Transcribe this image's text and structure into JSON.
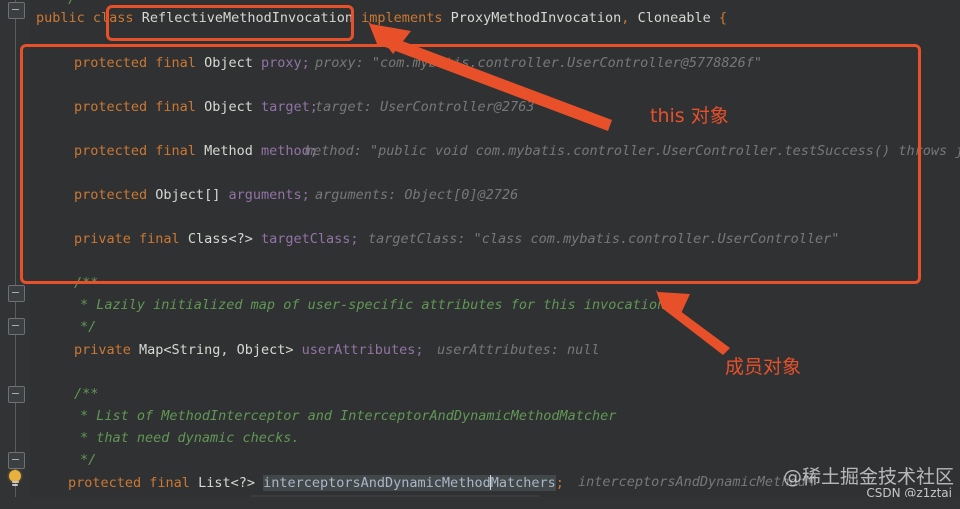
{
  "editor": {
    "theme_background": "#2f3133",
    "gutter_background": "#313335",
    "accent_annotation_color": "#e8502a",
    "comment_color": "#629755",
    "keyword_color": "#cc7832",
    "hint_color": "#787878"
  },
  "code_lines": [
    {
      "id": "l0",
      "text": "*/"
    },
    {
      "id": "l1",
      "text": "public class ReflectiveMethodInvocation implements ProxyMethodInvocation, Cloneable {"
    },
    {
      "id": "l2",
      "text": "protected final Object proxy;"
    },
    {
      "id": "l2h",
      "text": "proxy: \"com.mybatis.controller.UserController@5778826f\""
    },
    {
      "id": "l3",
      "text": "protected final Object target;"
    },
    {
      "id": "l3h",
      "text": "target: UserController@2763"
    },
    {
      "id": "l4",
      "text": "protected final Method method;"
    },
    {
      "id": "l4h",
      "text": "method: \"public void com.mybatis.controller.UserController.testSuccess() throws jav"
    },
    {
      "id": "l5",
      "text": "protected Object[] arguments;"
    },
    {
      "id": "l5h",
      "text": "arguments: Object[0]@2726"
    },
    {
      "id": "l6",
      "text": "private final Class<?> targetClass;"
    },
    {
      "id": "l6h",
      "text": "targetClass: \"class com.mybatis.controller.UserController\""
    },
    {
      "id": "l7",
      "text": "/**"
    },
    {
      "id": "l8",
      "text": "* Lazily initialized map of user-specific attributes for this invocation."
    },
    {
      "id": "l9",
      "text": "*/"
    },
    {
      "id": "l10",
      "text": "private Map<String, Object> userAttributes;"
    },
    {
      "id": "l10h",
      "text": "userAttributes: null"
    },
    {
      "id": "l11",
      "text": "/**"
    },
    {
      "id": "l12",
      "text": "* List of MethodInterceptor and InterceptorAndDynamicMethodMatcher"
    },
    {
      "id": "l13",
      "text": "* that need dynamic checks."
    },
    {
      "id": "l14",
      "text": "*/"
    },
    {
      "id": "l15",
      "text": "protected final List<?> interceptorsAndDynamicMethodMatchers;"
    },
    {
      "id": "l15h",
      "text": "interceptorsAndDynamicMethodM"
    }
  ],
  "tokens": {
    "kw_public": "public",
    "kw_class": "class",
    "kw_implements": "implements",
    "kw_protected": "protected",
    "kw_private": "private",
    "kw_final": "final",
    "cls_name": "ReflectiveMethodInvocation",
    "iface1": "ProxyMethodInvocation",
    "iface2": "Cloneable",
    "brace_open": "{",
    "comma": ",",
    "type_object": "Object",
    "type_object_array": "Object[]",
    "type_method": "Method",
    "type_class": "Class<?>",
    "type_map": "Map<String, Object>",
    "type_list": "List<?>",
    "field_proxy": "proxy;",
    "field_target": "target;",
    "field_method": "method;",
    "field_arguments": "arguments;",
    "field_targetclass": "targetClass;",
    "field_userattributes": "userAttributes;",
    "field_interceptors_a": "interceptorsAndDynamicMethod",
    "field_interceptors_b": "Matchers",
    "semicolon": ";",
    "comment_open": "/**",
    "comment_close": "*/",
    "cmt_lazily": "* Lazily initialized map of user-specific attributes for this invocation.",
    "cmt_list_of": "* List of MethodInterceptor and InterceptorAndDynamicMethodMatcher",
    "cmt_dynamic": "* that need dynamic checks.",
    "hint_proxy": "proxy: \"com.mybatis.controller.UserController@5778826f\"",
    "hint_target": "target: UserController@2763",
    "hint_method": "method: \"public void com.mybatis.controller.UserController.testSuccess() throws jav",
    "hint_arguments": "arguments: Object[0]@2726",
    "hint_targetclass": "targetClass: \"class com.mybatis.controller.UserController\"",
    "hint_userattributes": "userAttributes: null",
    "hint_interceptors": "interceptorsAndDynamicMethodM"
  },
  "annotations": {
    "class_name_box_label": "ReflectiveMethodInvocation",
    "fields_box_label": "this-object-fields",
    "label_this": "this 对象",
    "label_member": "成员对象",
    "arrow_top": "arrow-to-class-name",
    "arrow_bottom": "arrow-to-fields-box"
  },
  "watermark": {
    "cn": "@稀土掘金技术社区",
    "en": "CSDN @z1ztai"
  },
  "gutter": {
    "fold_markers": [
      "fold-1",
      "fold-2",
      "fold-3",
      "fold-4",
      "fold-5"
    ],
    "bulb": "intention-bulb"
  }
}
